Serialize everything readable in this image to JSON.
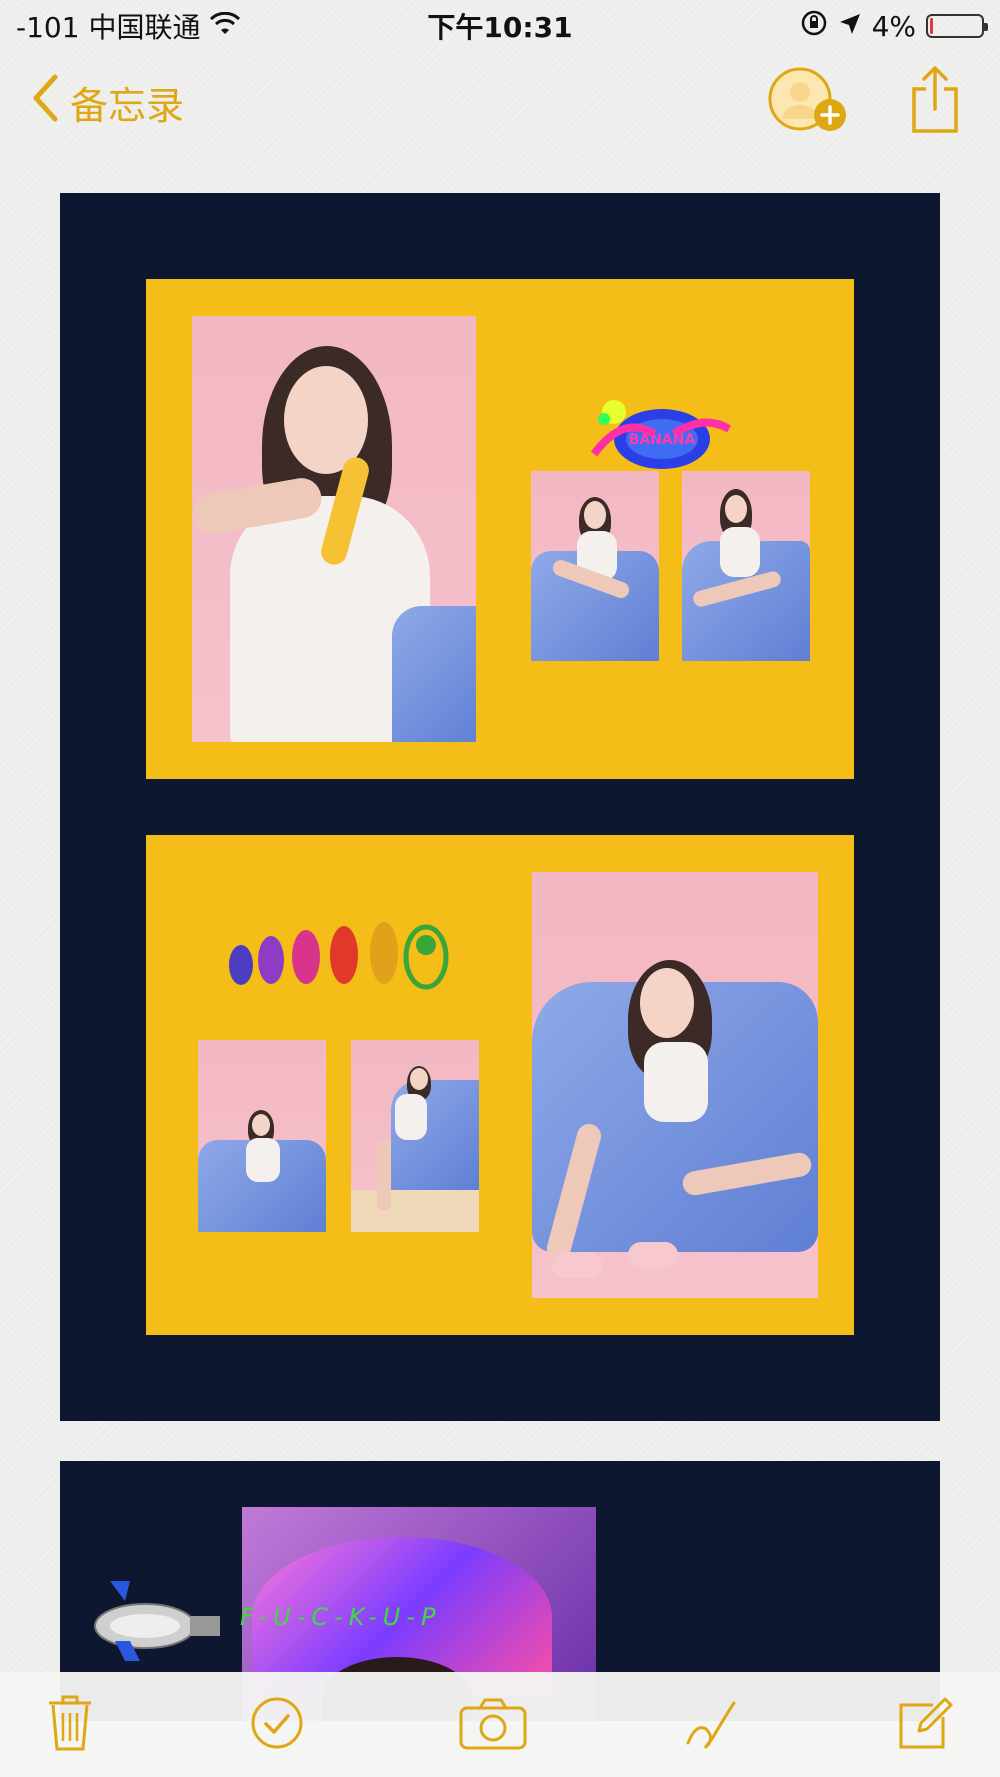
{
  "status_bar": {
    "carrier": "-101 中国联通",
    "time": "下午10:31",
    "battery_text": "4%",
    "battery_level_percent": 4
  },
  "nav": {
    "back_label": "备忘录"
  },
  "artwork": {
    "caption_text": "F-U-C-K-U-P"
  },
  "colors": {
    "accent": "#e0a714",
    "panel_navy": "#0e1730",
    "card_yellow": "#f4bd18",
    "photo_pink": "#f2b7c2",
    "paper_blue": "#7f9be2"
  },
  "toolbar": {
    "icons": [
      "trash-icon",
      "checklist-icon",
      "camera-icon",
      "sketch-icon",
      "compose-icon"
    ]
  }
}
